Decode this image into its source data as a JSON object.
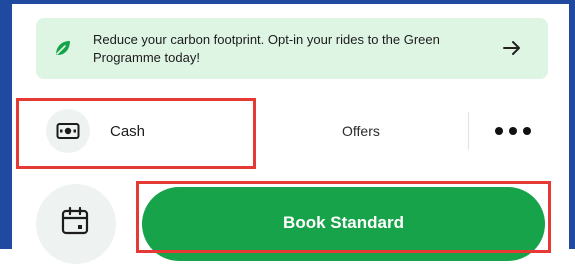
{
  "banner": {
    "text": "Reduce your carbon footprint. Opt-in your rides to the Green Programme today!",
    "icon": "leaf-icon",
    "action_icon": "arrow-right-icon"
  },
  "payment": {
    "method_label": "Cash",
    "method_icon": "cash-icon",
    "offers_label": "Offers",
    "more_icon": "more-dots-icon"
  },
  "booking": {
    "schedule_icon": "calendar-icon",
    "book_label": "Book Standard"
  },
  "colors": {
    "accent_green": "#16a34a",
    "banner_bg": "#dff5e4",
    "highlight_red": "#e53935",
    "frame_blue": "#1f4aa0"
  }
}
